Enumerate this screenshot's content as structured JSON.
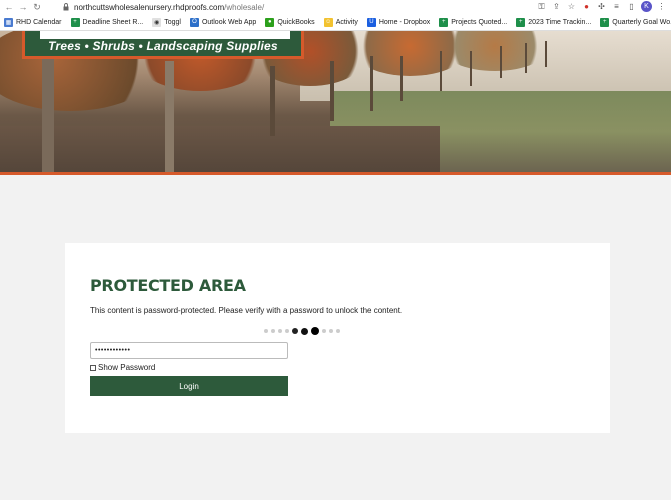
{
  "browser": {
    "url_host": "northcuttswholesalenursery.rhdproofs.com",
    "url_path": "/wholesale/",
    "avatar_letter": "K"
  },
  "bookmarks": [
    {
      "label": "RHD Calendar",
      "color": "#4a7bd0",
      "glyph": "▦"
    },
    {
      "label": "Deadline Sheet R...",
      "color": "#1e8f4a",
      "glyph": "+"
    },
    {
      "label": "Toggl",
      "color": "#e0e0e0",
      "glyph": "◉"
    },
    {
      "label": "Outlook Web App",
      "color": "#2c6fc9",
      "glyph": "O"
    },
    {
      "label": "QuickBooks",
      "color": "#2ca01c",
      "glyph": "●"
    },
    {
      "label": "Activity",
      "color": "#f2c230",
      "glyph": "☺"
    },
    {
      "label": "Home - Dropbox",
      "color": "#1b5fe0",
      "glyph": "U"
    },
    {
      "label": "Projects Quoted...",
      "color": "#1e8f4a",
      "glyph": "+"
    },
    {
      "label": "2023 Time Trackin...",
      "color": "#1e8f4a",
      "glyph": "+"
    },
    {
      "label": "Quarterly Goal Wo...",
      "color": "#1e8f4a",
      "glyph": "+"
    }
  ],
  "hero": {
    "tagline": "Trees • Shrubs • Landscaping Supplies",
    "brand_color": "#2d5a3b",
    "accent_color": "#d65a2b"
  },
  "card": {
    "title": "PROTECTED AREA",
    "description": "This content is password-protected. Please verify with a password to unlock the content.",
    "password_value": "••••••••••••",
    "show_password_label": "Show Password",
    "login_label": "Login"
  }
}
